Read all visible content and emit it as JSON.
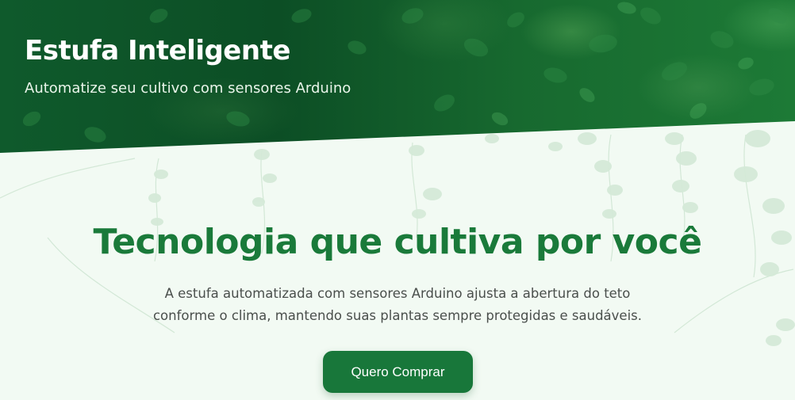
{
  "header": {
    "title": "Estufa Inteligente",
    "subtitle": "Automatize seu cultivo com sensores Arduino"
  },
  "main": {
    "headline": "Tecnologia que cultiva por você",
    "description_lines": [
      "A estufa automatizada com sensores Arduino ajusta a abertura do teto",
      "conforme o clima, mantendo suas plantas sempre protegidas e saudáveis."
    ],
    "cta_label": "Quero Comprar"
  },
  "colors": {
    "brand_green": "#18773a",
    "headline_green": "#1a7a3a",
    "hero_dark_green": "#0c4e25",
    "background": "#f2faf3"
  },
  "icons": [
    "foliage-background",
    "hanging-vine-decoration"
  ]
}
